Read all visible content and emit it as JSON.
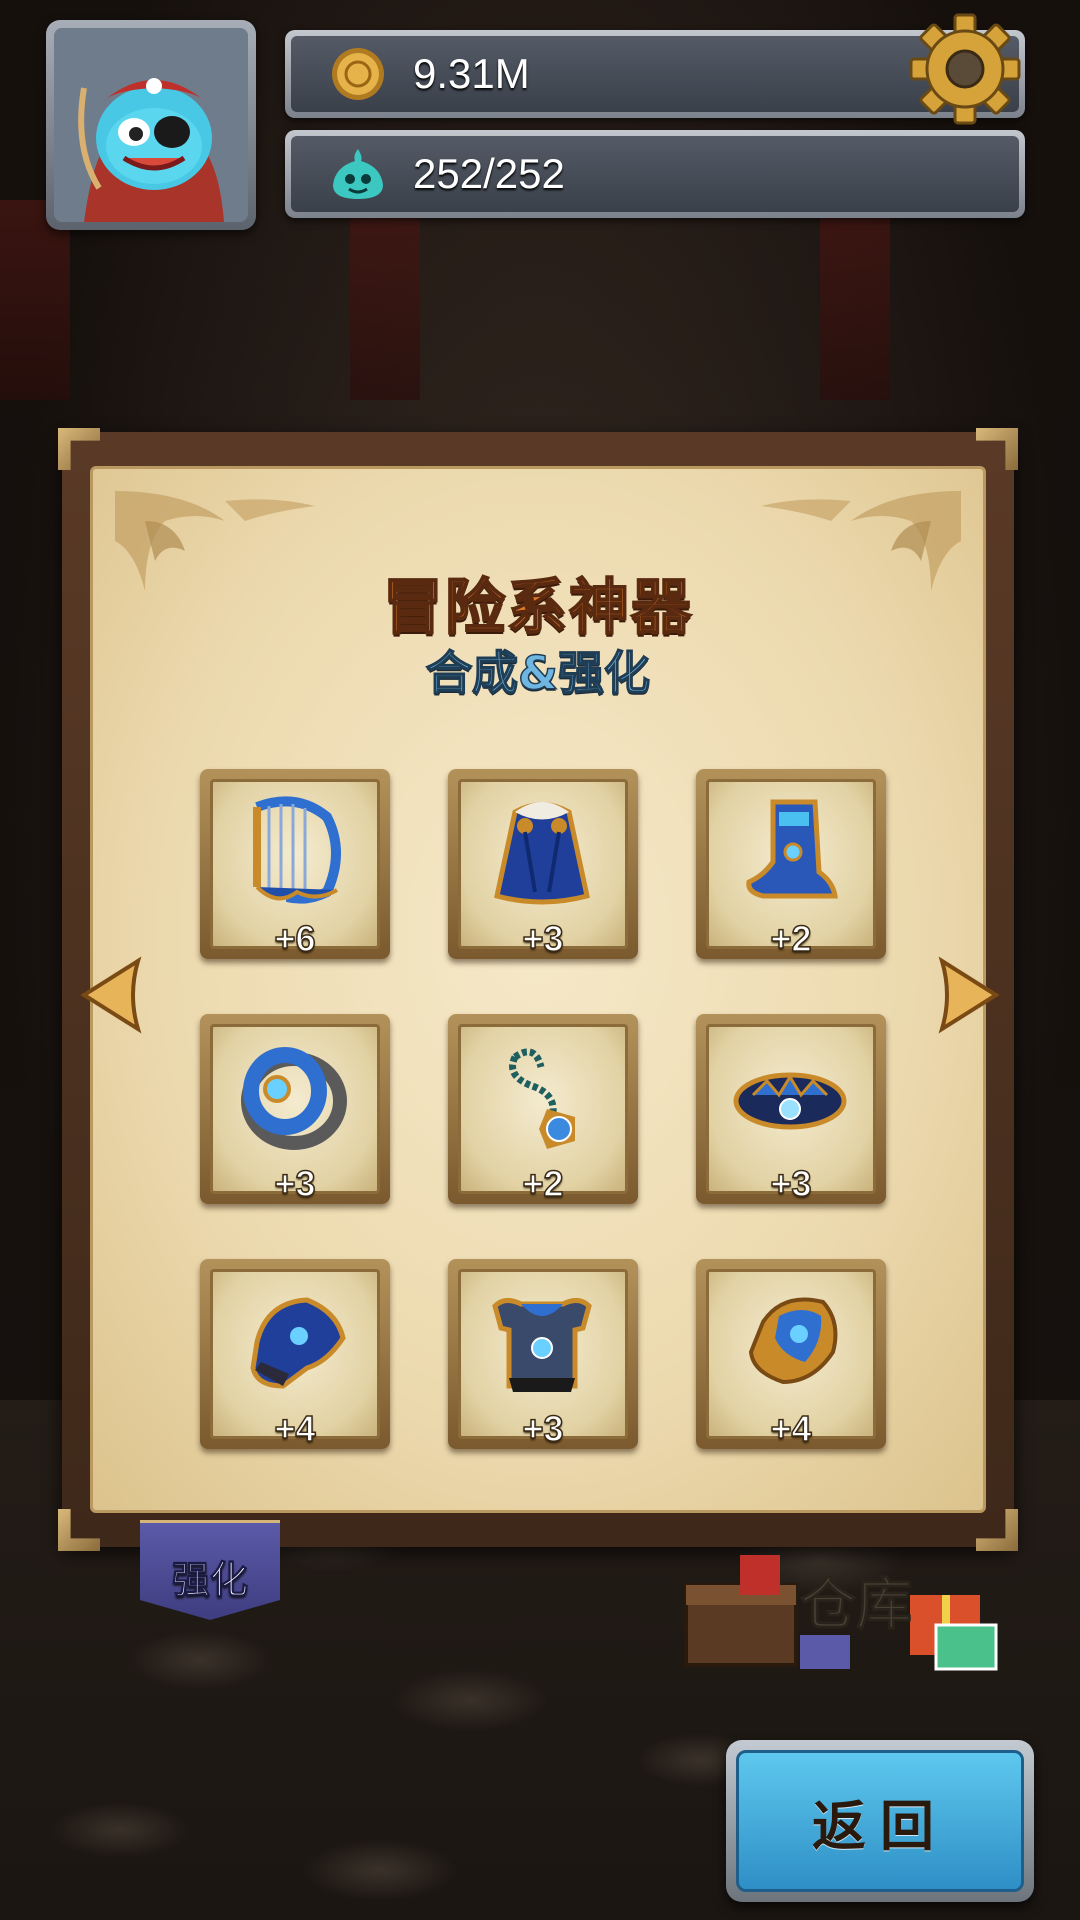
{
  "hud": {
    "gold": "9.31M",
    "energy": "252/252"
  },
  "panel": {
    "title": "冒险系神器",
    "subtitle": "合成&强化",
    "items": [
      {
        "icon": "harp-icon",
        "level": "+6"
      },
      {
        "icon": "cloak-icon",
        "level": "+3"
      },
      {
        "icon": "boots-icon",
        "level": "+2"
      },
      {
        "icon": "ring-icon",
        "level": "+3"
      },
      {
        "icon": "amulet-icon",
        "level": "+2"
      },
      {
        "icon": "crown-icon",
        "level": "+3"
      },
      {
        "icon": "gauntlet-icon",
        "level": "+4"
      },
      {
        "icon": "armor-icon",
        "level": "+3"
      },
      {
        "icon": "pauldron-icon",
        "level": "+4"
      }
    ]
  },
  "tabs": {
    "enhance": "强化",
    "storage": "仓库"
  },
  "buttons": {
    "back": "返回"
  },
  "colors": {
    "title": "#e07a2a",
    "subtitle": "#6fb6e0",
    "back_button": "#3aa8dc",
    "tab": "#4f4e96"
  }
}
